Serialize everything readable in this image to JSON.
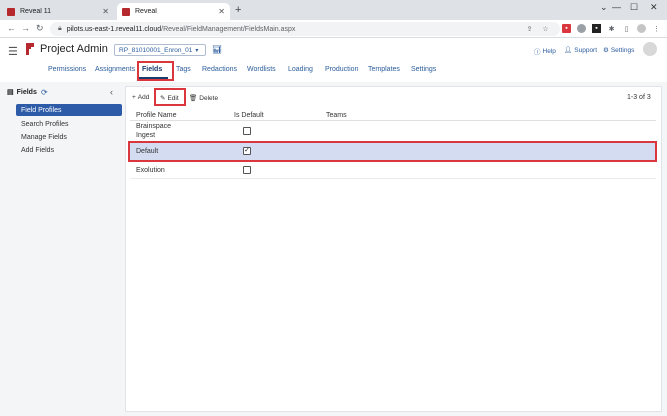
{
  "browser": {
    "tabs": [
      {
        "label": "Reveal 11",
        "active": false
      },
      {
        "label": "Reveal",
        "active": true
      }
    ],
    "url_host": "pilots.us-east-1.reveal11.cloud",
    "url_path": "/Reveal/FieldManagement/FieldsMain.aspx",
    "window_controls": [
      "minimize",
      "maximize",
      "close"
    ]
  },
  "header": {
    "app_title": "Project Admin",
    "project_select": "RP_81010001_Enron_01",
    "links": {
      "help": "Help",
      "support": "Support",
      "settings": "Settings"
    }
  },
  "nav": {
    "tabs": [
      {
        "label": "Permissions"
      },
      {
        "label": "Assignments"
      },
      {
        "label": "Fields"
      },
      {
        "label": "Tags"
      },
      {
        "label": "Redactions"
      },
      {
        "label": "Wordlists"
      },
      {
        "label": "Loading"
      },
      {
        "label": "Production"
      },
      {
        "label": "Templates"
      },
      {
        "label": "Settings"
      }
    ],
    "active": "Fields"
  },
  "sidebar": {
    "title": "Fields",
    "items": [
      {
        "label": "Field Profiles",
        "active": true
      },
      {
        "label": "Search Profiles",
        "active": false
      },
      {
        "label": "Manage Fields",
        "active": false
      },
      {
        "label": "Add Fields",
        "active": false
      }
    ]
  },
  "toolbar": {
    "add_label": "Add",
    "edit_label": "Edit",
    "delete_label": "Delete",
    "counter": "1-3 of 3"
  },
  "table": {
    "columns": [
      "Profile Name",
      "Is Default",
      "Teams"
    ],
    "rows": [
      {
        "name_line1": "Brainspace",
        "name_line2": "Ingest",
        "is_default": false,
        "selected": false
      },
      {
        "name": "Default",
        "is_default": true,
        "selected": true
      },
      {
        "name": "Exolution",
        "is_default": false,
        "selected": false
      }
    ]
  },
  "colors": {
    "accent": "#2d5ba8",
    "highlight_border": "#d9363e",
    "selected_row": "#d4dcf2",
    "brand": "#b5282e"
  }
}
